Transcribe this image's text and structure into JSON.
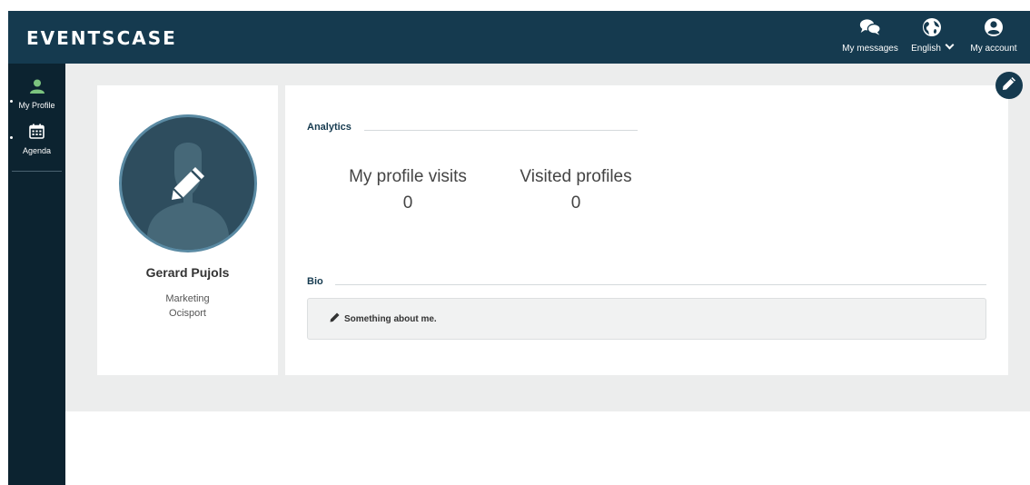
{
  "app": {
    "brand": "EVENTSCASE"
  },
  "header": {
    "actions": [
      {
        "icon": "chat-bubbles-icon",
        "label": "My messages"
      },
      {
        "icon": "globe-icon",
        "label": "English"
      },
      {
        "icon": "user-circle-icon",
        "label": "My account"
      }
    ]
  },
  "sidebar": {
    "items": [
      {
        "icon": "user-icon",
        "label": "My Profile",
        "active": true
      },
      {
        "icon": "calendar-icon",
        "label": "Agenda",
        "active": false
      }
    ]
  },
  "profile": {
    "name": "Gerard Pujols",
    "department": "Marketing",
    "company": "Ocisport"
  },
  "analytics": {
    "title": "Analytics",
    "stats": [
      {
        "label": "My profile visits",
        "value": "0"
      },
      {
        "label": "Visited profiles",
        "value": "0"
      }
    ]
  },
  "bio": {
    "title": "Bio",
    "placeholder": "Something about me."
  },
  "colors": {
    "header": "#153a4f",
    "sidebar": "#0c2330",
    "active_icon": "#7cc47f",
    "background": "#eceded",
    "avatar": "#2e4d5e"
  }
}
